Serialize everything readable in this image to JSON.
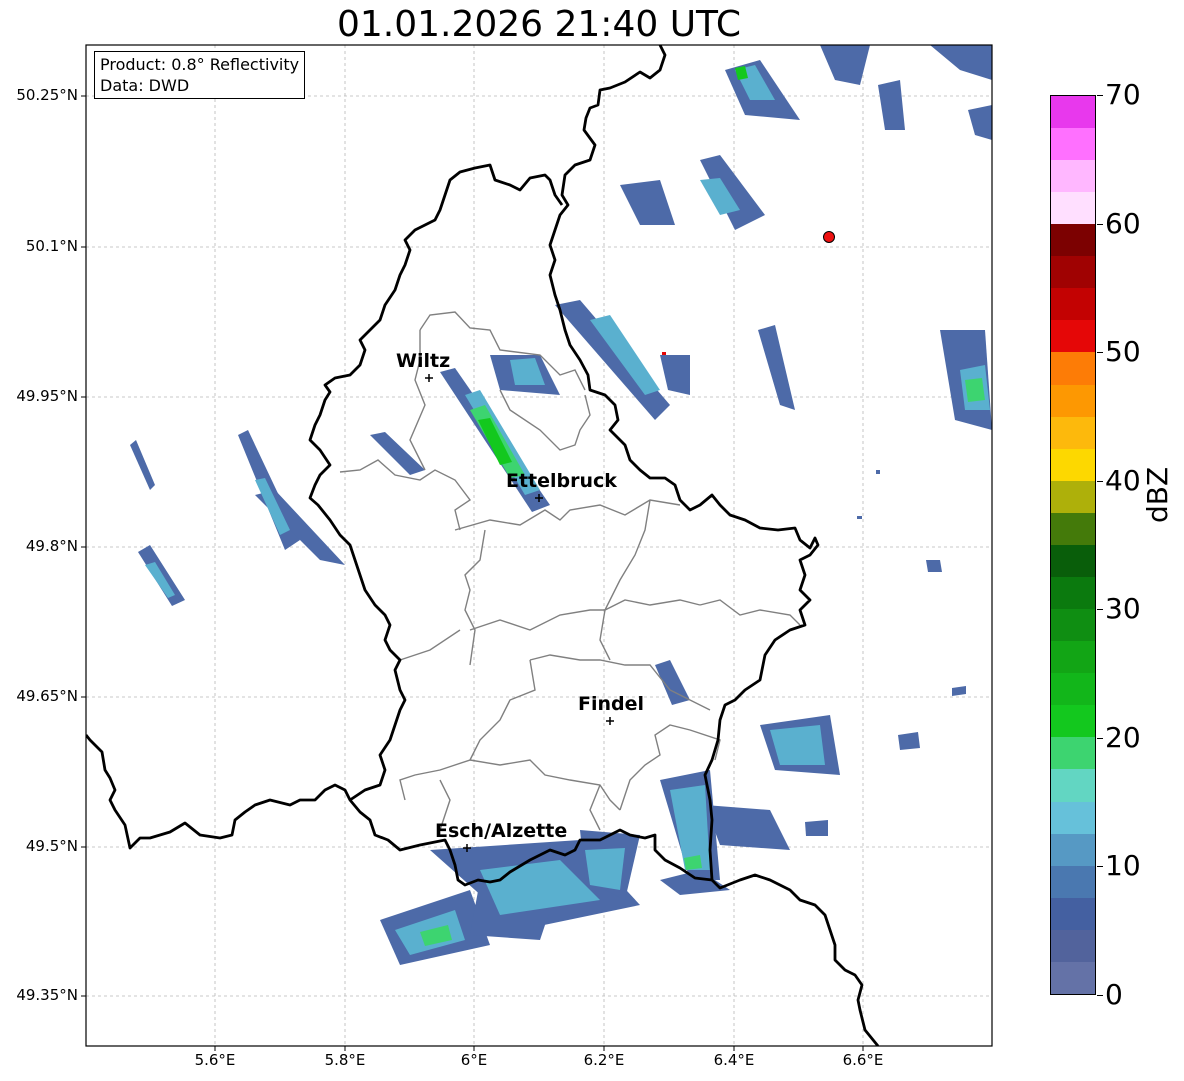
{
  "title": "01.01.2026 21:40 UTC",
  "info": {
    "product": "Product: 0.8° Reflectivity",
    "data": "Data: DWD"
  },
  "lat_labels": [
    "50.25°N",
    "50.1°N",
    "49.95°N",
    "49.8°N",
    "49.65°N",
    "49.5°N",
    "49.35°N"
  ],
  "lon_labels": [
    "5.6°E",
    "5.8°E",
    "6°E",
    "6.2°E",
    "6.4°E",
    "6.6°E"
  ],
  "cities": [
    {
      "name": "Wiltz"
    },
    {
      "name": "Ettelbruck"
    },
    {
      "name": "Findel"
    },
    {
      "name": "Esch/Alzette"
    }
  ],
  "colorbar": {
    "label": "dBZ",
    "ticks": [
      "0",
      "10",
      "20",
      "30",
      "40",
      "50",
      "60",
      "70"
    ],
    "colors": [
      "#6472a7",
      "#52639c",
      "#4460a1",
      "#4a78b0",
      "#5699c4",
      "#66c1da",
      "#62d6c2",
      "#3dd470",
      "#13c81e",
      "#12b61a",
      "#12a515",
      "#0f8e12",
      "#0b7a0e",
      "#095e0a",
      "#447a0a",
      "#aeb00a",
      "#fdd800",
      "#fdb90c",
      "#fd9802",
      "#fd7c06",
      "#e50707",
      "#c30202",
      "#a00202",
      "#7c0101",
      "#ffdfff",
      "#ffb7ff",
      "#ff70ff",
      "#e838ed"
    ]
  },
  "colors": {
    "border": "#000000",
    "communes": "#808080",
    "radar_site": "#ee1111"
  }
}
